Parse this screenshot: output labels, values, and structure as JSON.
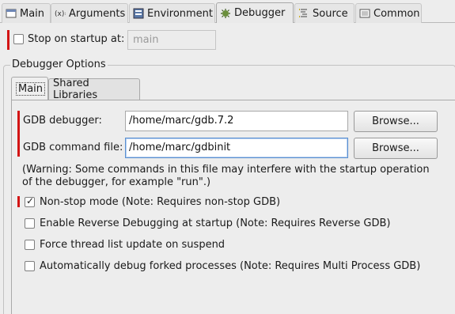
{
  "tabs": [
    {
      "label": "Main",
      "icon": "main-tab-icon",
      "active": false
    },
    {
      "label": "Arguments",
      "icon": "arguments-icon",
      "active": false
    },
    {
      "label": "Environment",
      "icon": "environment-icon",
      "active": false
    },
    {
      "label": "Debugger",
      "icon": "debugger-icon",
      "active": true
    },
    {
      "label": "Source",
      "icon": "source-icon",
      "active": false
    },
    {
      "label": "Common",
      "icon": "common-icon",
      "active": false
    }
  ],
  "stop_on_startup": {
    "label": "Stop on startup at:",
    "checked": false,
    "value": "main"
  },
  "debugger_options": {
    "title": "Debugger Options",
    "tabs": [
      {
        "label": "Main",
        "active": true
      },
      {
        "label": "Shared Libraries",
        "active": false
      }
    ],
    "gdb_debugger": {
      "label": "GDB debugger:",
      "value": "/home/marc/gdb.7.2",
      "button": "Browse..."
    },
    "gdb_command_file": {
      "label": "GDB command file:",
      "value": "/home/marc/gdbinit",
      "button": "Browse..."
    },
    "warning_line1": "(Warning: Some commands in this file may interfere with the startup operation",
    "warning_line2": "of the debugger, for example \"run\".)",
    "options": [
      {
        "label": "Non-stop mode (Note: Requires non-stop GDB)",
        "checked": true
      },
      {
        "label": "Enable Reverse Debugging at startup (Note: Requires Reverse GDB)",
        "checked": false
      },
      {
        "label": "Force thread list update on suspend",
        "checked": false
      },
      {
        "label": "Automatically debug forked processes (Note: Requires Multi Process GDB)",
        "checked": false
      }
    ]
  },
  "colors": {
    "required_marker": "#d31414",
    "focus_border": "#5b8fd0"
  }
}
